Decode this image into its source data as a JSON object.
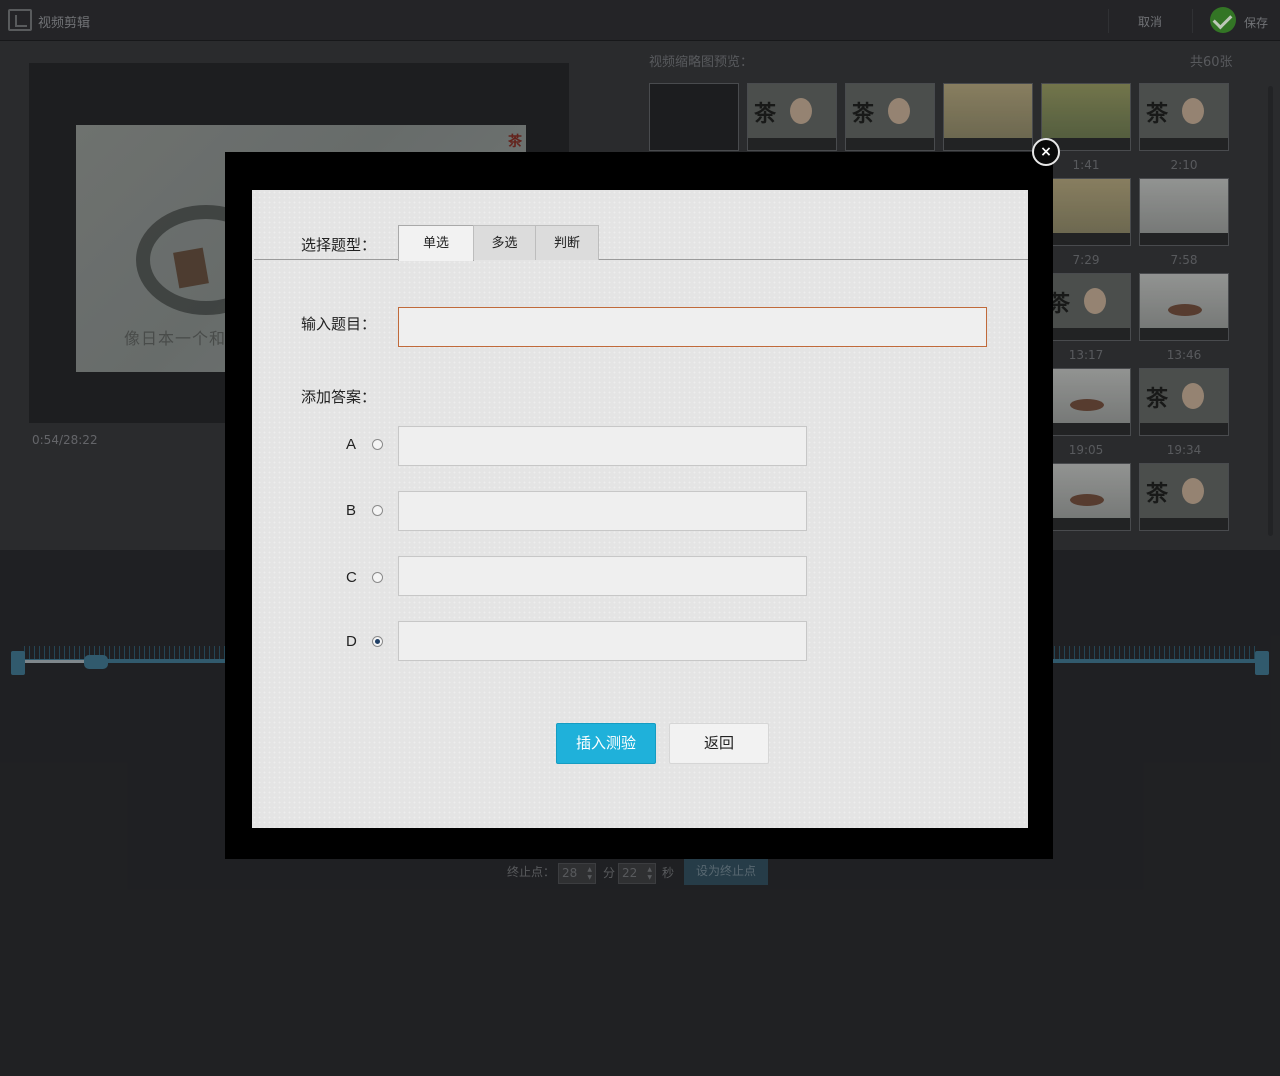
{
  "app": {
    "title": "视频剪辑",
    "cancel_label": "取消",
    "save_label": "保存",
    "accent_color": "#1fb1da"
  },
  "player": {
    "subtitle_text": "像日本一个和尚",
    "brand_text": "茶",
    "timecode": "0:54/28:22"
  },
  "thumbnails": {
    "title": "视频缩略图预览：",
    "count_label": "共60张",
    "times": [
      "1:41",
      "2:10",
      "7:29",
      "7:58",
      "13:17",
      "13:46",
      "19:05",
      "19:34"
    ],
    "tea_glyph": "茶"
  },
  "trim": {
    "end_label": "终止点：",
    "minutes_value": "28",
    "minutes_unit": "分",
    "seconds_value": "22",
    "seconds_unit": "秒",
    "set_end_label": "设为终止点"
  },
  "modal": {
    "close_icon": "×",
    "type_label": "选择题型：",
    "tabs": [
      {
        "label": "单选",
        "active": true
      },
      {
        "label": "多选",
        "active": false
      },
      {
        "label": "判断",
        "active": false
      }
    ],
    "question_label": "输入题目：",
    "question_value": "",
    "question_placeholder": "",
    "answers_label": "添加答案：",
    "options": [
      {
        "letter": "A",
        "checked": false,
        "value": ""
      },
      {
        "letter": "B",
        "checked": false,
        "value": ""
      },
      {
        "letter": "C",
        "checked": false,
        "value": ""
      },
      {
        "letter": "D",
        "checked": true,
        "value": ""
      }
    ],
    "insert_label": "插入测验",
    "back_label": "返回"
  }
}
